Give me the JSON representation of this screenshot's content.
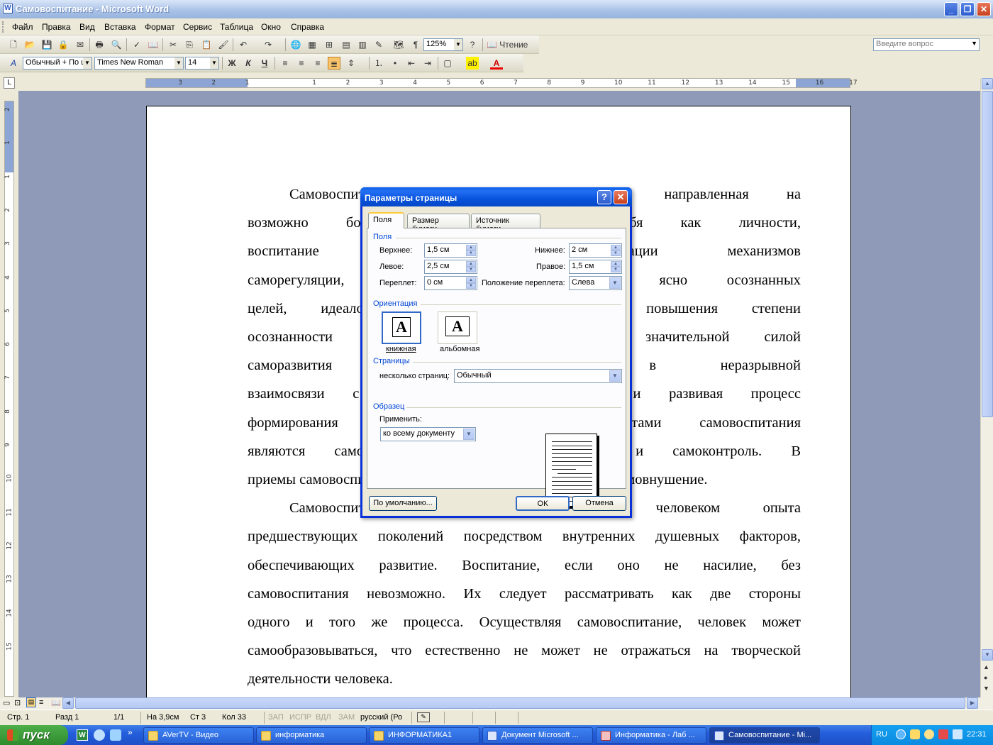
{
  "window": {
    "title": "Самовоспитание - Microsoft Word",
    "app_icon": "W"
  },
  "menu": [
    "Файл",
    "Правка",
    "Вид",
    "Вставка",
    "Формат",
    "Сервис",
    "Таблица",
    "Окно",
    "Справка"
  ],
  "ask": {
    "placeholder": "Введите вопрос"
  },
  "toolbar": {
    "zoom": "125%",
    "read_label": "Чтение",
    "style": "Обычный + По ц",
    "font": "Times New Roman",
    "size": "14"
  },
  "ruler": {
    "h_ticks": [
      "3",
      "2",
      "1",
      "1",
      "2",
      "3",
      "4",
      "5",
      "6",
      "7",
      "8",
      "9",
      "10",
      "11",
      "12",
      "13",
      "14",
      "15",
      "16",
      "17"
    ],
    "v_ticks": [
      "2",
      "1",
      "1",
      "2",
      "3",
      "4",
      "5",
      "6",
      "7",
      "8",
      "9",
      "10",
      "11",
      "12",
      "13",
      "14",
      "15"
    ]
  },
  "document": {
    "lines": [
      "Самовоспитание — это деятельность, направленная на",
      "возможно более полную реализацию себя как личности,",
      "воспитание самостоятельности, активизации механизмов",
      "саморегуляции, проявляющихся в наличие ясно осознанных",
      "целей, идеалов и личностных смыслов, повышения степени",
      "осознанности своей деятельности и ее значительной силой",
      "саморазвития личности, находится в неразрывной",
      "взаимосвязи с воспитанием, дополняя его и развивая процесс",
      "формирования личности. Основными элементами самовоспитания",
      "являются самоанализ, самооценка, самоотчет и самоконтроль. В",
      "приемы самовоспитания: самоубеждение, самоободрение, самовнушение.",
      "Самовоспитание — это усвоение человеком опыта",
      "предшествующих поколений посредством внутренних душевных факторов,",
      "обеспечивающих развитие. Воспитание, если оно не насилие, без",
      "самовоспитания невозможно. Их следует рассматривать как две стороны",
      "одного и того же процесса. Осуществляя самовоспитание, человек может",
      "самообразовываться, что естественно не может не отражаться на творческой",
      "деятельности человека."
    ]
  },
  "dialog": {
    "title": "Параметры страницы",
    "help": "?",
    "close": "✕",
    "tabs": [
      "Поля",
      "Размер бумаги",
      "Источник бумаги"
    ],
    "margins_group": "Поля",
    "top_label": "Верхнее:",
    "top_value": "1,5 см",
    "left_label": "Левое:",
    "left_value": "2,5 см",
    "gutter_label": "Переплет:",
    "gutter_value": "0 см",
    "bottom_label": "Нижнее:",
    "bottom_value": "2 см",
    "right_label": "Правое:",
    "right_value": "1,5 см",
    "gutter_pos_label": "Положение переплета:",
    "gutter_pos_value": "Слева",
    "orientation_group": "Ориентация",
    "portrait": "книжная",
    "landscape": "альбомная",
    "pages_group": "Страницы",
    "multiple_label": "несколько страниц:",
    "multiple_value": "Обычный",
    "sample_group": "Образец",
    "apply_label": "Применить:",
    "apply_value": "ко всему документу",
    "default_btn": "По умолчанию...",
    "ok_btn": "ОК",
    "cancel_btn": "Отмена"
  },
  "status": {
    "page": "Стр. 1",
    "section": "Разд 1",
    "pages": "1/1",
    "at": "На 3,9см",
    "line": "Ст 3",
    "col": "Кол 33",
    "rec": "ЗАП",
    "trk": "ИСПР",
    "ext": "ВДЛ",
    "ovr": "ЗАМ",
    "lang": "русский (Ро"
  },
  "taskbar": {
    "start": "пуск",
    "tasks": [
      "AVerTV - Видео",
      "информатика",
      "ИНФОРМАТИКА1",
      "Документ Microsoft ...",
      "Информатика - Лаб ...",
      "Самовоспитание - Mi..."
    ],
    "lang": "RU",
    "time": "22:31"
  }
}
